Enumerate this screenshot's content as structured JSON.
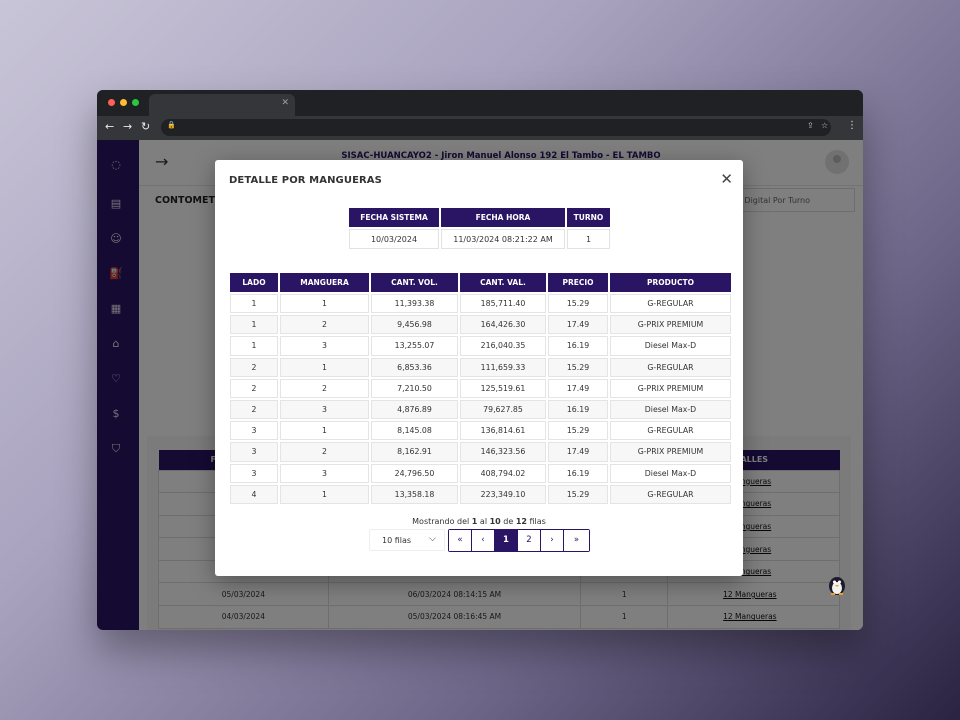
{
  "app": {
    "site_title": "SISAC-HUANCAYO2 - Jiron Manuel Alonso 192 El Tambo - EL TAMBO",
    "page_title": "CONTOMETR",
    "page_tab": "metro Digital Por Turno",
    "background_table": {
      "headers": [
        "F",
        "",
        "",
        "TALLES"
      ],
      "rows": [
        [
          "",
          "",
          "",
          "angueras"
        ],
        [
          "",
          "",
          "",
          "angueras"
        ],
        [
          "",
          "",
          "",
          "angueras"
        ],
        [
          "",
          "",
          "",
          "angueras"
        ],
        [
          "",
          "",
          "",
          "angueras"
        ],
        [
          "05/03/2024",
          "06/03/2024 08:14:15 AM",
          "1",
          "12 Mangueras"
        ],
        [
          "04/03/2024",
          "05/03/2024 08:16:45 AM",
          "1",
          "12 Mangueras"
        ]
      ]
    }
  },
  "modal": {
    "title": "DETALLE POR MANGUERAS",
    "close_icon": "close-icon",
    "info_table": {
      "headers": [
        "FECHA SISTEMA",
        "FECHA HORA",
        "TURNO"
      ],
      "row": [
        "10/03/2024",
        "11/03/2024 08:21:22 AM",
        "1"
      ]
    },
    "detail_table": {
      "headers": [
        "LADO",
        "MANGUERA",
        "CANT. VOL.",
        "CANT. VAL.",
        "PRECIO",
        "PRODUCTO"
      ],
      "rows": [
        [
          "1",
          "1",
          "11,393.38",
          "185,711.40",
          "15.29",
          "G-REGULAR"
        ],
        [
          "1",
          "2",
          "9,456.98",
          "164,426.30",
          "17.49",
          "G-PRIX PREMIUM"
        ],
        [
          "1",
          "3",
          "13,255.07",
          "216,040.35",
          "16.19",
          "Diesel Max-D"
        ],
        [
          "2",
          "1",
          "6,853.36",
          "111,659.33",
          "15.29",
          "G-REGULAR"
        ],
        [
          "2",
          "2",
          "7,210.50",
          "125,519.61",
          "17.49",
          "G-PRIX PREMIUM"
        ],
        [
          "2",
          "3",
          "4,876.89",
          "79,627.85",
          "16.19",
          "Diesel Max-D"
        ],
        [
          "3",
          "1",
          "8,145.08",
          "136,814.61",
          "15.29",
          "G-REGULAR"
        ],
        [
          "3",
          "2",
          "8,162.91",
          "146,323.56",
          "17.49",
          "G-PRIX PREMIUM"
        ],
        [
          "3",
          "3",
          "24,796.50",
          "408,794.02",
          "16.19",
          "Diesel Max-D"
        ],
        [
          "4",
          "1",
          "13,358.18",
          "223,349.10",
          "15.29",
          "G-REGULAR"
        ]
      ]
    },
    "pagination": {
      "showing_prefix": "Mostrando del",
      "from": "1",
      "al": "al",
      "to": "10",
      "de": "de",
      "total": "12",
      "suffix": "filas",
      "rows_select": "10 filas",
      "first": "«",
      "prev": "‹",
      "pages": [
        "1",
        "2"
      ],
      "next": "›",
      "last": "»"
    }
  },
  "colors": {
    "primary": "#2a1464",
    "overlay": "rgba(0,0,0,0.5)"
  }
}
